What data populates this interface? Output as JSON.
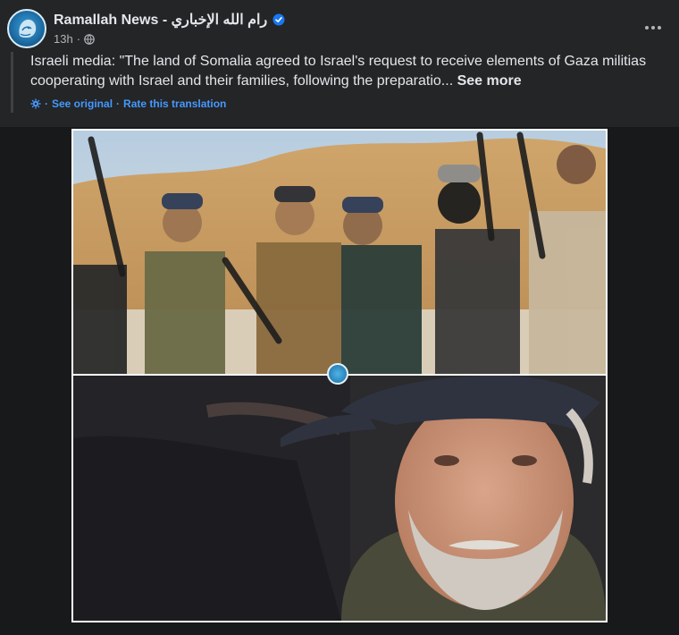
{
  "post": {
    "page_name": "Ramallah News - رام الله الإخباري",
    "timestamp": "13h",
    "separator": "·",
    "text": "Israeli media: \"The land of Somalia agreed to Israel's request to receive elements of Gaza militias cooperating with Israel and their families, following the preparatio...",
    "see_more": "See more",
    "see_original": "See original",
    "link_separator": "·",
    "rate_translation": "Rate this translation",
    "prefix_separator": "·"
  },
  "icons": {
    "avatar": "ramallah-news-logo",
    "verified": "verified-badge-icon",
    "audience": "globe-icon",
    "more": "more-options-icon",
    "translate": "gear-icon"
  },
  "colors": {
    "background": "#242526",
    "text": "#e4e6eb",
    "secondary": "#b0b3b8",
    "link": "#4599ff",
    "verified": "#1877f2"
  }
}
